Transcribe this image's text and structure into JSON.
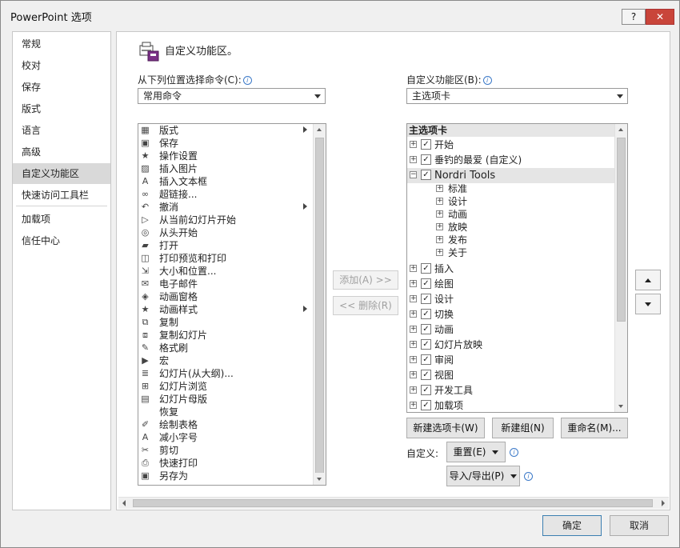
{
  "window": {
    "title": "PowerPoint 选项",
    "help_label": "?",
    "close_label": "✕"
  },
  "nav": {
    "items": [
      {
        "label": "常规"
      },
      {
        "label": "校对"
      },
      {
        "label": "保存"
      },
      {
        "label": "版式"
      },
      {
        "label": "语言"
      },
      {
        "label": "高级"
      },
      {
        "label": "自定义功能区",
        "selected": true
      },
      {
        "label": "快速访问工具栏"
      },
      {
        "label": "加载项"
      },
      {
        "label": "信任中心"
      }
    ]
  },
  "header": {
    "title": "自定义功能区。"
  },
  "choose": {
    "label": "从下列位置选择命令(C):",
    "info_icon": "i",
    "selected": "常用命令"
  },
  "customize": {
    "label": "自定义功能区(B):",
    "info_icon": "i",
    "selected": "主选项卡"
  },
  "commands": [
    {
      "label": "版式",
      "icon": "▦",
      "submenu": true
    },
    {
      "label": "保存",
      "icon": "▣"
    },
    {
      "label": "操作设置",
      "icon": "★"
    },
    {
      "label": "插入图片",
      "icon": "▨"
    },
    {
      "label": "插入文本框",
      "icon": "A"
    },
    {
      "label": "超链接...",
      "icon": "∞"
    },
    {
      "label": "撤消",
      "icon": "↶",
      "submenu": true
    },
    {
      "label": "从当前幻灯片开始",
      "icon": "▷"
    },
    {
      "label": "从头开始",
      "icon": "◎"
    },
    {
      "label": "打开",
      "icon": "▰"
    },
    {
      "label": "打印预览和打印",
      "icon": "◫"
    },
    {
      "label": "大小和位置...",
      "icon": "⇲"
    },
    {
      "label": "电子邮件",
      "icon": "✉"
    },
    {
      "label": "动画窗格",
      "icon": "◈"
    },
    {
      "label": "动画样式",
      "icon": "★",
      "submenu": true
    },
    {
      "label": "复制",
      "icon": "⧉"
    },
    {
      "label": "复制幻灯片",
      "icon": "⧈"
    },
    {
      "label": "格式刷",
      "icon": "✎"
    },
    {
      "label": "宏",
      "icon": "▶"
    },
    {
      "label": "幻灯片(从大纲)...",
      "icon": "≣"
    },
    {
      "label": "幻灯片浏览",
      "icon": "⊞"
    },
    {
      "label": "幻灯片母版",
      "icon": "▤"
    },
    {
      "label": "恢复",
      "icon": ""
    },
    {
      "label": "绘制表格",
      "icon": "✐"
    },
    {
      "label": "减小字号",
      "icon": "A"
    },
    {
      "label": "剪切",
      "icon": "✂"
    },
    {
      "label": "快速打印",
      "icon": "⎙"
    },
    {
      "label": "另存为",
      "icon": "▣"
    }
  ],
  "middle": {
    "add_label": "添加(A) >>",
    "remove_label": "<< 删除(R)"
  },
  "tree": {
    "header": "主选项卡",
    "expand_glyph": "+",
    "collapse_glyph": "−",
    "check_glyph": "✓",
    "rows": [
      {
        "label": "开始",
        "checked": true
      },
      {
        "label": "垂钓的最爱 (自定义)",
        "checked": true
      },
      {
        "label": "Nordri Tools",
        "checked": true,
        "expanded": true,
        "highlight": true
      },
      {
        "label": "插入",
        "checked": true
      },
      {
        "label": "绘图",
        "checked": true
      },
      {
        "label": "设计",
        "checked": true
      },
      {
        "label": "切换",
        "checked": true
      },
      {
        "label": "动画",
        "checked": true
      },
      {
        "label": "幻灯片放映",
        "checked": true
      },
      {
        "label": "审阅",
        "checked": true
      },
      {
        "label": "视图",
        "checked": true
      },
      {
        "label": "开发工具",
        "checked": true
      },
      {
        "label": "加载项",
        "checked": true
      }
    ],
    "groups": [
      "标准",
      "设计",
      "动画",
      "放映",
      "发布",
      "关于"
    ]
  },
  "buttons": {
    "new_tab": "新建选项卡(W)",
    "new_group": "新建组(N)",
    "rename": "重命名(M)...",
    "customize_label": "自定义:",
    "reset": "重置(E)",
    "import_export": "导入/导出(P)"
  },
  "footer": {
    "ok": "确定",
    "cancel": "取消"
  }
}
